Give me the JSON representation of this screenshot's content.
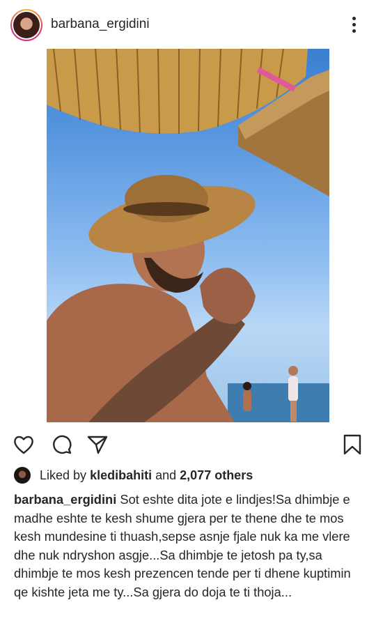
{
  "post": {
    "username": "barbana_ergidini",
    "liked_by_prefix": "Liked by",
    "liked_by_user": "kledibahiti",
    "liked_by_and": "and",
    "liked_by_others": "2,077 others",
    "caption_user": "barbana_ergidini",
    "caption_text": "Sot eshte dita jote e lindjes!Sa dhimbje e madhe eshte te kesh shume gjera per te thene dhe te mos kesh mundesine ti thuash,sepse asnje fjale nuk ka me vlere dhe nuk ndryshon asgje...Sa dhimbje te jetosh pa ty,sa dhimbje te mos kesh prezencen tende per ti dhene kuptimin qe kishte jeta me ty...Sa gjera do doja te ti thoja..."
  },
  "icons": {
    "more": "more-vertical-icon",
    "like": "heart-icon",
    "comment": "comment-icon",
    "share": "paper-plane-icon",
    "save": "bookmark-icon"
  },
  "colors": {
    "text": "#262626",
    "story_ring_start": "#f9b233",
    "story_ring_end": "#c13584"
  }
}
